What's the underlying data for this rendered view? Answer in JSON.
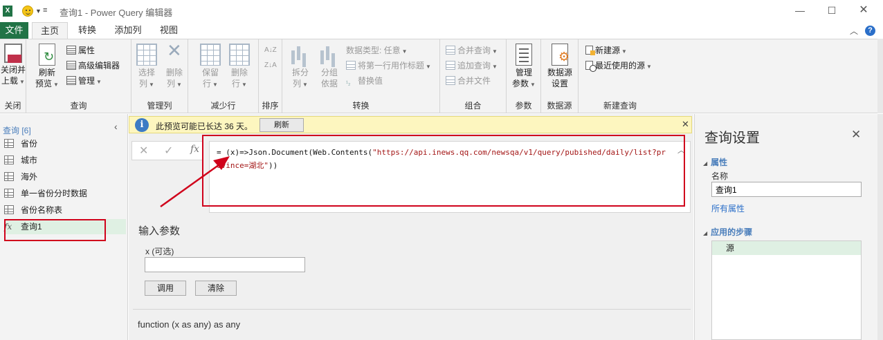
{
  "window": {
    "title": "查询1 - Power Query 编辑器",
    "app_logo": "X",
    "minimize": "—",
    "maximize": "☐",
    "close": "✕"
  },
  "tabs": [
    {
      "label": "文件"
    },
    {
      "label": "主页"
    },
    {
      "label": "转换"
    },
    {
      "label": "添加列"
    },
    {
      "label": "视图"
    }
  ],
  "ribbon": {
    "close": {
      "group_label": "关闭",
      "close_load": {
        "line1": "关闭并",
        "line2": "上载"
      }
    },
    "query": {
      "group_label": "查询",
      "refresh_preview": {
        "line1": "刷新",
        "line2": "预览"
      },
      "properties": "属性",
      "advanced_editor": "高级编辑器",
      "manage": "管理"
    },
    "manage_columns": {
      "group_label": "管理列",
      "choose_columns": {
        "line1": "选择",
        "line2": "列"
      },
      "remove_columns": {
        "line1": "删除",
        "line2": "列"
      }
    },
    "reduce_rows": {
      "group_label": "减少行",
      "keep_rows": {
        "line1": "保留",
        "line2": "行"
      },
      "remove_rows": {
        "line1": "删除",
        "line2": "行"
      }
    },
    "sort": {
      "group_label": "排序",
      "asc": "A↓Z",
      "desc": "Z↓A"
    },
    "transform": {
      "group_label": "转换",
      "split_column": {
        "line1": "拆分",
        "line2": "列"
      },
      "group_by": {
        "line1": "分组",
        "line2": "依据"
      },
      "data_type": "数据类型: 任意",
      "first_row_header": "将第一行用作标题",
      "replace_values": "替换值"
    },
    "combine": {
      "group_label": "组合",
      "merge_queries": "合并查询",
      "append_queries": "追加查询",
      "combine_files": "合并文件"
    },
    "parameters": {
      "group_label": "参数",
      "manage_params": {
        "line1": "管理",
        "line2": "参数"
      }
    },
    "data_sources": {
      "group_label": "数据源",
      "settings": {
        "line1": "数据源",
        "line2": "设置"
      }
    },
    "new_query": {
      "group_label": "新建查询",
      "new_source": "新建源",
      "recent_sources": "最近使用的源"
    }
  },
  "queries_pane": {
    "header": "查询 [6]",
    "items": [
      {
        "label": "省份",
        "icon": "table-icon"
      },
      {
        "label": "城市",
        "icon": "table-icon"
      },
      {
        "label": "海外",
        "icon": "table-icon"
      },
      {
        "label": "单一省份分时数据",
        "icon": "table-icon"
      },
      {
        "label": "省份名称表",
        "icon": "table-icon"
      },
      {
        "label": "查询1",
        "icon": "fx-icon"
      }
    ]
  },
  "info_bar": {
    "text": "此预览可能已长达 36 天。",
    "refresh_label": "刷新"
  },
  "formula_bar": {
    "cancel": "✕",
    "commit": "✓",
    "fx": "fx",
    "prefix": "= (x)=>Json.Document(Web.Contents(",
    "url": "\"https://api.inews.qq.com/newsqa/v1/query/pubished/daily/list?province=湖北\"",
    "suffix": "))"
  },
  "parameters_panel": {
    "title": "输入参数",
    "param_label": "x (可选)",
    "param_value": "",
    "invoke_label": "调用",
    "clear_label": "清除",
    "function_signature": "function (x as any) as any"
  },
  "query_settings": {
    "title": "查询设置",
    "properties_header": "属性",
    "name_label": "名称",
    "name_value": "查询1",
    "all_properties_link": "所有属性",
    "applied_steps_header": "应用的步骤",
    "steps": [
      "源"
    ]
  },
  "colors": {
    "excel_green": "#217346",
    "highlight_red": "#d0021b",
    "info_bar_bg": "#fdf6bf",
    "selected_green": "#dff0e3",
    "link_blue": "#2b6fc9"
  }
}
